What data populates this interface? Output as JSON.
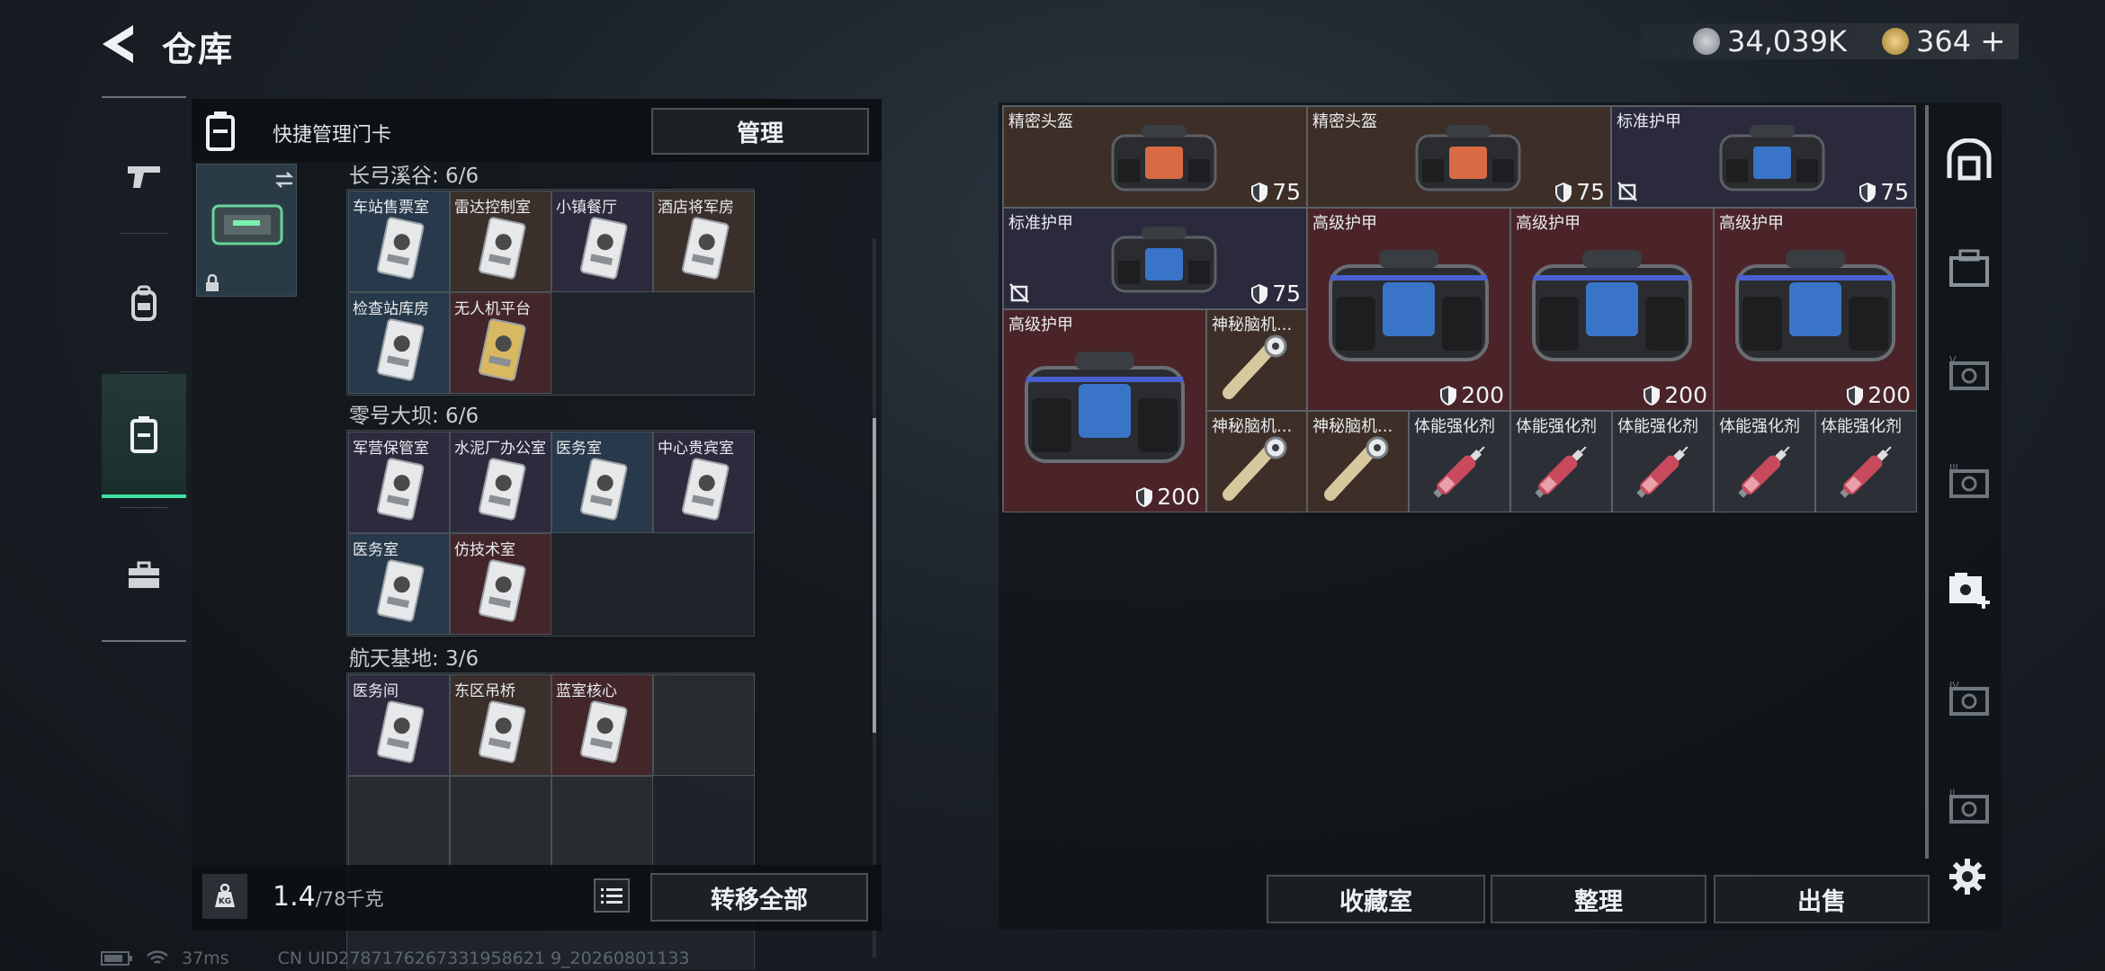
{
  "header": {
    "title": "仓库",
    "currency": {
      "main_amount": "34,039K",
      "premium_amount": "364"
    }
  },
  "keycard_panel": {
    "header_label": "快捷管理门卡",
    "manage_label": "管理",
    "zones": [
      {
        "title": "长弓溪谷: 6/6",
        "slots": [
          {
            "label": "车站售票室",
            "color": "blue"
          },
          {
            "label": "雷达控制室",
            "color": "brown"
          },
          {
            "label": "小镇餐厅",
            "color": "purple"
          },
          {
            "label": "酒店将军房",
            "color": "brown"
          },
          {
            "label": "检查站库房",
            "color": "blue"
          },
          {
            "label": "无人机平台",
            "color": "red"
          }
        ]
      },
      {
        "title": "零号大坝: 6/6",
        "slots": [
          {
            "label": "军营保管室",
            "color": "purple"
          },
          {
            "label": "水泥厂办公室",
            "color": "purple"
          },
          {
            "label": "医务室",
            "color": "blue"
          },
          {
            "label": "中心贵宾室",
            "color": "purple"
          },
          {
            "label": "医务室",
            "color": "blue"
          },
          {
            "label": "仿技术室",
            "color": "red"
          }
        ]
      },
      {
        "title": "航天基地: 3/6",
        "slots": [
          {
            "label": "医务间",
            "color": "purple"
          },
          {
            "label": "东区吊桥",
            "color": "brown"
          },
          {
            "label": "蓝室核心",
            "color": "red"
          }
        ]
      }
    ],
    "weight_current": "1.4",
    "weight_max": "/78千克",
    "transfer_all_label": "转移全部"
  },
  "stash": {
    "items": [
      {
        "name": "精密头盔",
        "value": "75",
        "color": "brown"
      },
      {
        "name": "精密头盔",
        "value": "75",
        "color": "brown"
      },
      {
        "name": "标准护甲",
        "value": "75",
        "color": "purple"
      },
      {
        "name": "标准护甲",
        "value": "75",
        "color": "purple"
      },
      {
        "name": "高级护甲",
        "value": "200",
        "color": "red"
      },
      {
        "name": "高级护甲",
        "value": "200",
        "color": "red"
      },
      {
        "name": "高级护甲",
        "value": "200",
        "color": "red"
      },
      {
        "name": "高级护甲",
        "value": "200",
        "color": "red"
      },
      {
        "name": "神秘脑机...",
        "color": "brown"
      },
      {
        "name": "神秘脑机...",
        "color": "brown"
      },
      {
        "name": "神秘脑机...",
        "color": "brown"
      },
      {
        "name": "体能强化剂",
        "color": "plain"
      },
      {
        "name": "体能强化剂",
        "color": "plain"
      },
      {
        "name": "体能强化剂",
        "color": "plain"
      },
      {
        "name": "体能强化剂",
        "color": "plain"
      },
      {
        "name": "体能强化剂",
        "color": "plain"
      }
    ],
    "buttons": {
      "collection": "收藏室",
      "sort": "整理",
      "sell": "出售"
    }
  },
  "status_bar": {
    "ping": "37ms",
    "uid": "CN UID2787176267331958621 9_20260801133"
  },
  "colors": {
    "accent_green": "#3fe0a2",
    "card_blue": "#27394a",
    "card_brown": "#3a2f2a",
    "card_purple": "#2c2a3c",
    "card_red": "#43262a"
  },
  "icons": [
    "back-arrow-icon",
    "gun-icon",
    "backpack-icon",
    "keycard-icon",
    "briefcase-icon",
    "armor-shield-icon",
    "settings-gear-icon",
    "list-icon",
    "weight-icon"
  ]
}
